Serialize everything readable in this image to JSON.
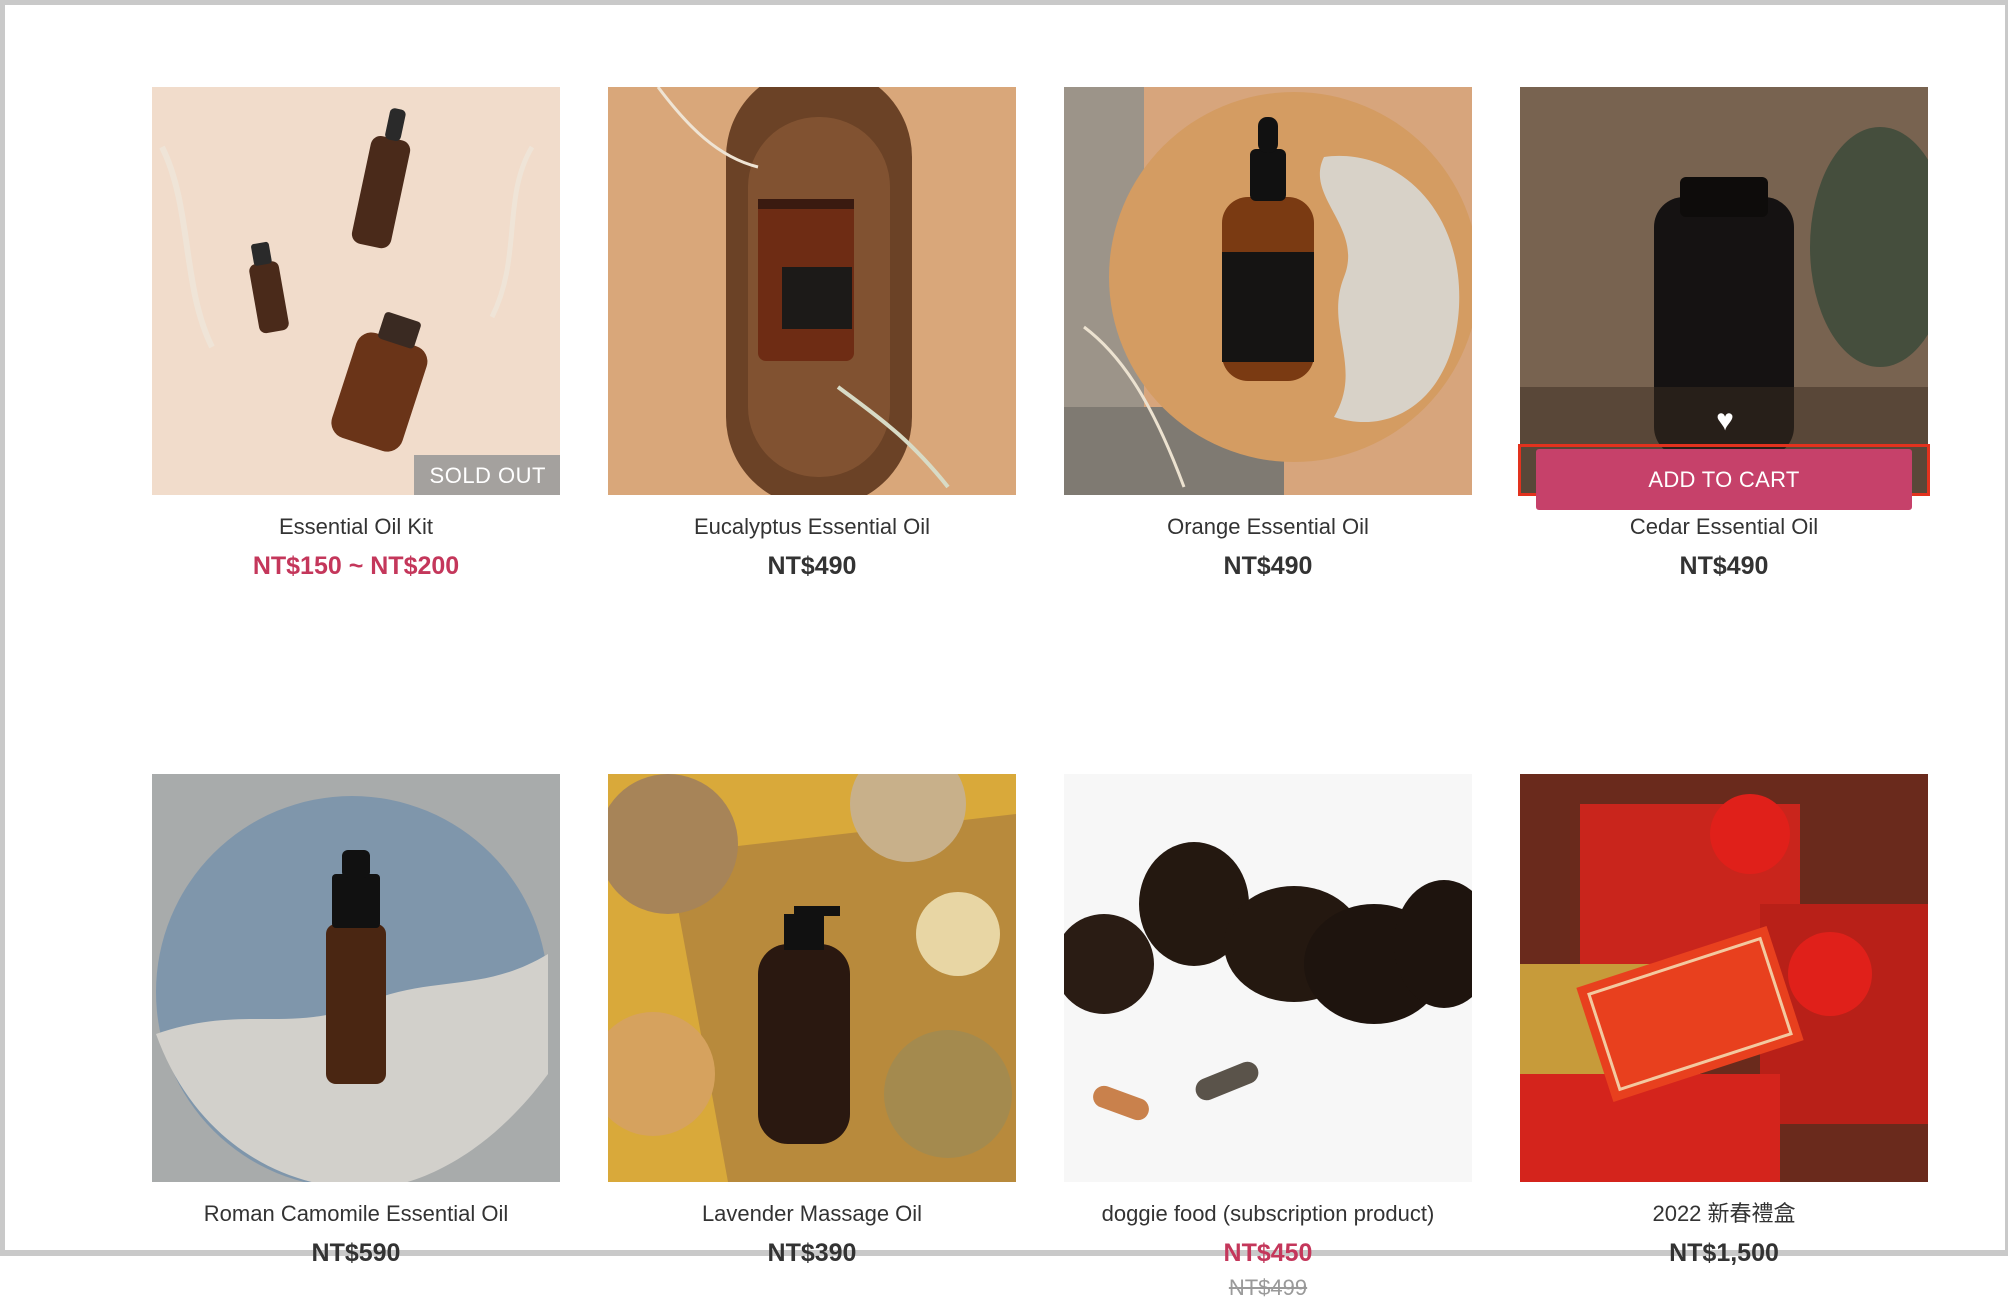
{
  "products": [
    {
      "name": "Essential Oil Kit",
      "price": "NT$150 ~ NT$200",
      "badge": "SOLD OUT"
    },
    {
      "name": "Eucalyptus Essential Oil",
      "price": "NT$490"
    },
    {
      "name": "Orange Essential Oil",
      "price": "NT$490"
    },
    {
      "name": "Cedar Essential Oil",
      "price": "NT$490",
      "cta": "ADD TO CART"
    },
    {
      "name": "Roman Camomile Essential Oil",
      "price": "NT$590"
    },
    {
      "name": "Lavender Massage Oil",
      "price": "NT$390"
    },
    {
      "name": "doggie food (subscription product)",
      "price": "NT$450",
      "original_price": "NT$499"
    },
    {
      "name": "2022 新春禮盒",
      "price": "NT$1,500"
    }
  ],
  "icons": {
    "wishlist": "heart-icon"
  },
  "colors": {
    "sale_price": "#c4375b",
    "add_to_cart": "#c6416a",
    "highlight": "#e2321e"
  }
}
